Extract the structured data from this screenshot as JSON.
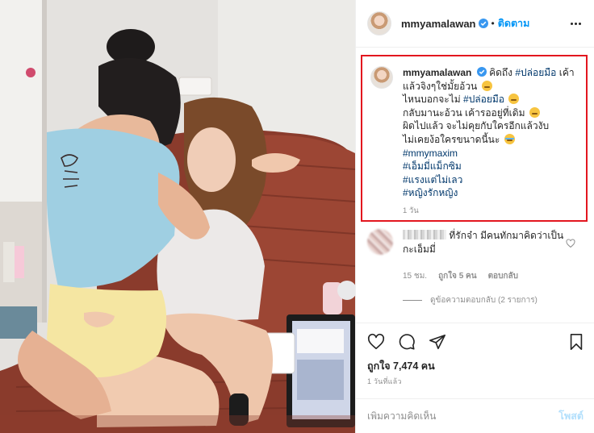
{
  "header": {
    "username": "mmyamalawan",
    "separator": "•",
    "follow_label": "ติดตาม"
  },
  "caption": {
    "username": "mmyamalawan",
    "line1": "คิดถึง",
    "tag1": "#ปล่อยมือ",
    "line1b": "เค้าแล้วจิงๆใช่มั้ยอ้วน",
    "line2": "ไหนบอกจะไม่",
    "tag2": "#ปล่อยมือ",
    "line3": "กลับมานะอ้วน เค้ารออยู่ที่เดิม",
    "line4": "ผิดไปแล้ว จะไม่คุยกับใครอีกแล้วงับ",
    "line5": "ไม่เคยง้อใครขนาดนี้นะ",
    "hashtags": [
      "#mmymaxim",
      "#เอ็มมี่แม็กซิม",
      "#แรงแต่ไม่เลว",
      "#หญิงรักหญิง"
    ],
    "time": "1 วัน"
  },
  "comment": {
    "text": "ที่รักจ๋า มีคนทักมาคิดว่าเป็นกะเอ็มมี่",
    "time": "15 ชม.",
    "likes": "ถูกใจ 5 คน",
    "reply_label": "ตอบกลับ",
    "view_replies": "ดูข้อความตอบกลับ (2 รายการ)"
  },
  "post": {
    "likes": "ถูกใจ 7,474 คน",
    "time": "1 วันที่แล้ว"
  },
  "add_comment": {
    "placeholder": "เพิ่มความคิดเห็น",
    "post_label": "โพสต์"
  },
  "icons": {
    "verified": "verified-badge-icon",
    "more": "more-options-icon",
    "like": "heart-icon",
    "comment": "comment-bubble-icon",
    "share": "paper-plane-icon",
    "save": "bookmark-icon"
  },
  "colors": {
    "accent": "#0095f6",
    "hashtag": "#00376b",
    "highlight_box": "#e3161f",
    "muted": "#8e8e8e"
  }
}
